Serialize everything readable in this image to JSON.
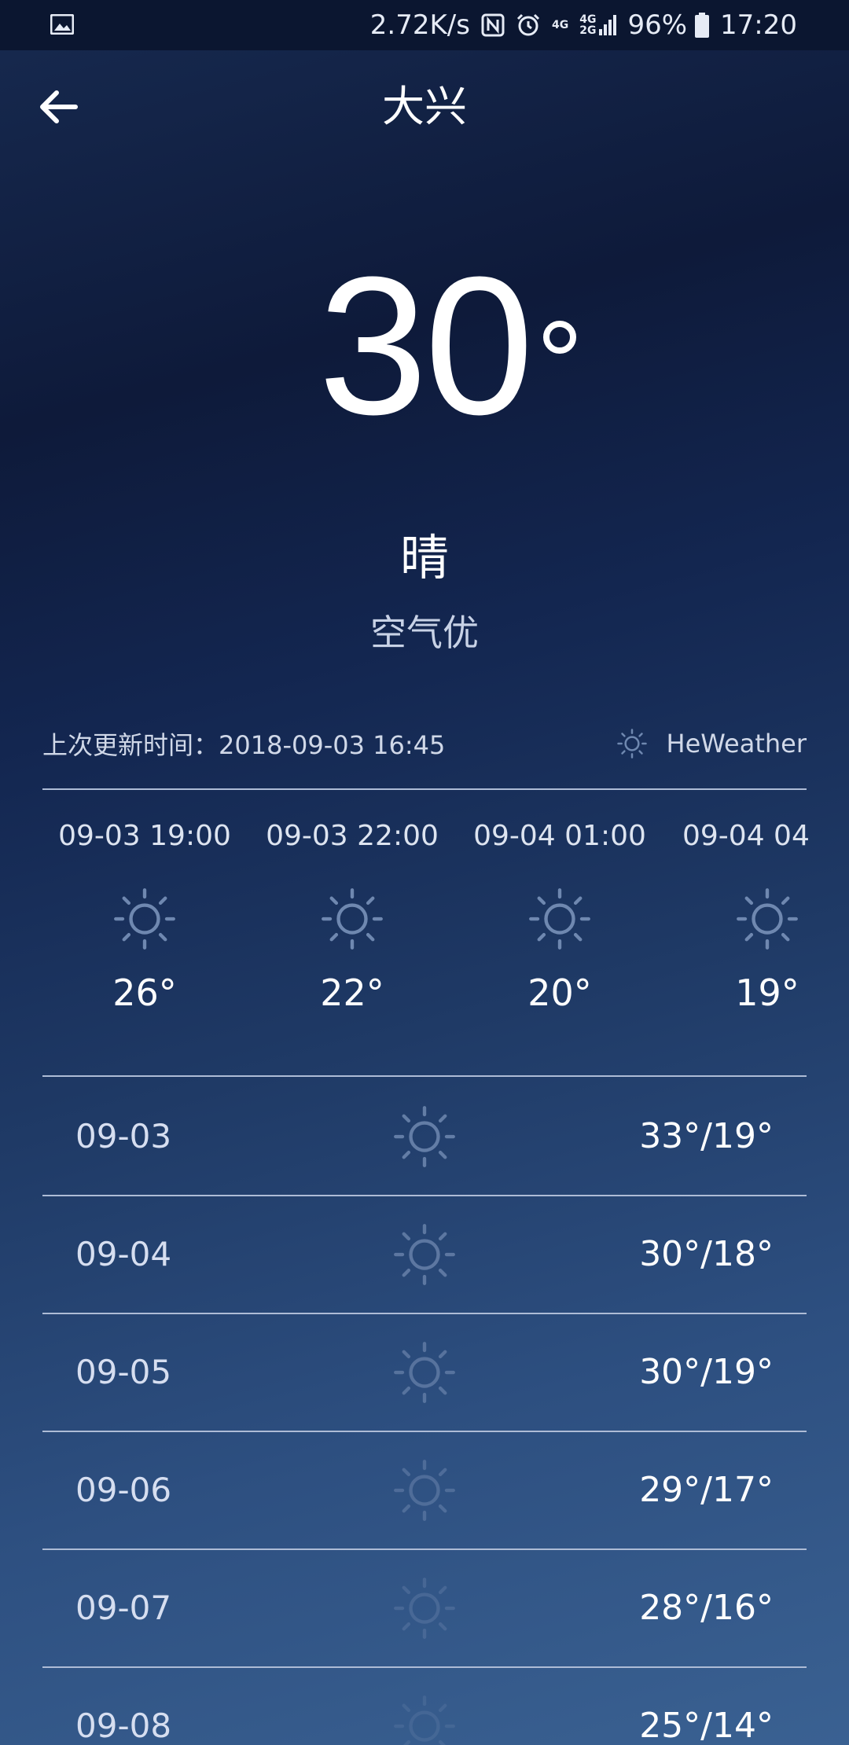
{
  "status_bar": {
    "net_speed": "2.72K/s",
    "signal_1": "4G",
    "signal_2_top": "4G",
    "signal_2_bottom": "2G",
    "battery": "96%",
    "time": "17:20"
  },
  "header": {
    "city": "大兴"
  },
  "current": {
    "temperature": "30",
    "condition": "晴",
    "air_quality": "空气优",
    "updated_label": "上次更新时间：2018-09-03 16:45",
    "source": "HeWeather"
  },
  "hourly": [
    {
      "time": "09-03 19:00",
      "icon": "sun-icon",
      "temp": "26°"
    },
    {
      "time": "09-03 22:00",
      "icon": "sun-icon",
      "temp": "22°"
    },
    {
      "time": "09-04 01:00",
      "icon": "sun-icon",
      "temp": "20°"
    },
    {
      "time": "09-04 04",
      "icon": "sun-icon",
      "temp": "19°"
    }
  ],
  "daily": [
    {
      "date": "09-03",
      "icon": "sun-icon",
      "range": "33°/19°"
    },
    {
      "date": "09-04",
      "icon": "sun-icon",
      "range": "30°/18°"
    },
    {
      "date": "09-05",
      "icon": "sun-icon",
      "range": "30°/19°"
    },
    {
      "date": "09-06",
      "icon": "sun-icon",
      "range": "29°/17°"
    },
    {
      "date": "09-07",
      "icon": "sun-icon",
      "range": "28°/16°"
    },
    {
      "date": "09-08",
      "icon": "sun-icon",
      "range": "25°/14°"
    }
  ],
  "colors": {
    "status_bar_bg": "#0b1630",
    "background_top": "#0e1a3a",
    "background_bottom": "#3a6192",
    "divider": "#aebcd6",
    "icon": "#6f88b0"
  }
}
